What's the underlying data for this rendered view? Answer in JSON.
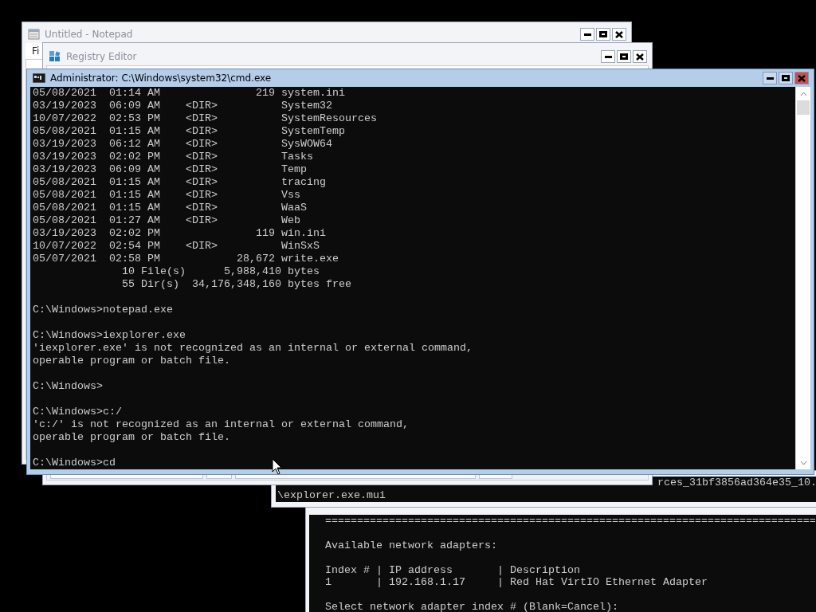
{
  "notepad": {
    "title": "Untitled - Notepad",
    "active": false,
    "menu": [
      "Fi"
    ]
  },
  "registry_editor": {
    "title": "Registry Editor",
    "active": false
  },
  "console_behind": {
    "lines": [
      "rces_31bf3856ad364e35_10.",
      "\\explorer.exe.mui"
    ]
  },
  "console_lower": {
    "blocks": [
      [
        "============================================================================="
      ],
      [
        "Available network adapters:"
      ],
      [
        "Index # | IP address       | Description",
        "1       | 192.168.1.17     | Red Hat VirtIO Ethernet Adapter"
      ],
      [
        "Select network adapter index # (Blank=Cancel):"
      ]
    ]
  },
  "command_prompt": {
    "title": "Administrator: C:\\Windows\\system32\\cmd.exe",
    "active": true,
    "blocks": [
      [
        "05/08/2021  01:14 AM               219 system.ini",
        "03/19/2023  06:09 AM    <DIR>          System32",
        "10/07/2022  02:53 PM    <DIR>          SystemResources",
        "05/08/2021  01:15 AM    <DIR>          SystemTemp",
        "03/19/2023  06:12 AM    <DIR>          SysWOW64",
        "03/19/2023  02:02 PM    <DIR>          Tasks",
        "03/19/2023  06:09 AM    <DIR>          Temp",
        "05/08/2021  01:15 AM    <DIR>          tracing",
        "05/08/2021  01:15 AM    <DIR>          Vss",
        "05/08/2021  01:15 AM    <DIR>          WaaS",
        "05/08/2021  01:27 AM    <DIR>          Web",
        "03/19/2023  02:02 PM               119 win.ini",
        "10/07/2022  02:54 PM    <DIR>          WinSxS",
        "05/07/2021  02:58 PM            28,672 write.exe",
        "              10 File(s)      5,988,410 bytes",
        "              55 Dir(s)  34,176,348,160 bytes free"
      ],
      [
        "C:\\Windows>notepad.exe"
      ],
      [
        "C:\\Windows>iexplorer.exe",
        "'iexplorer.exe' is not recognized as an internal or external command,",
        "operable program or batch file."
      ],
      [
        "C:\\Windows>"
      ],
      [
        "C:\\Windows>c:/",
        "'c:/' is not recognized as an internal or external command,",
        "operable program or batch file."
      ],
      [
        "C:\\Windows>cd"
      ]
    ]
  }
}
